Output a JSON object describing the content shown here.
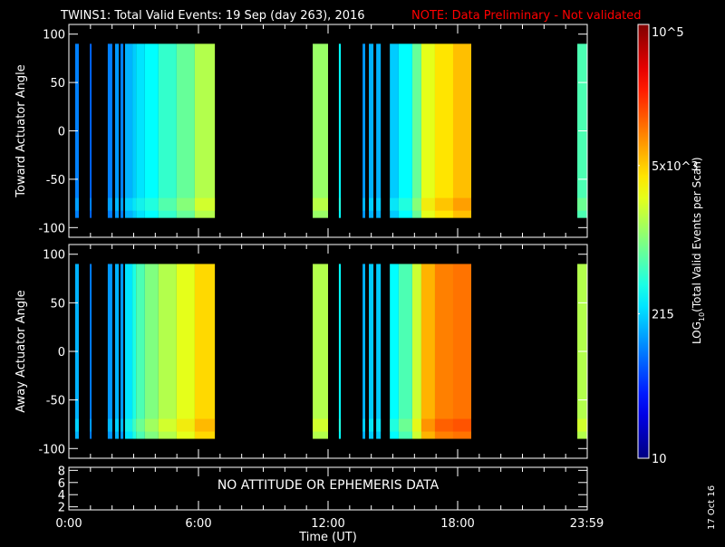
{
  "title": "TWINS1: Total Valid Events: 19 Sep (day 263), 2016",
  "note": "NOTE: Data Preliminary - Not validated",
  "date_stamp": "17 Oct 16",
  "chart_data": [
    {
      "type": "heatmap",
      "panel": "toward",
      "ylabel": "Toward Actuator Angle",
      "ylim": [
        -110,
        110
      ],
      "yticks": [
        "100",
        "50",
        "0",
        "-50",
        "-100"
      ],
      "data_range_deg": [
        -90,
        90
      ],
      "segments_hours_log10": [
        [
          0.29,
          0.46,
          2.0
        ],
        [
          0.97,
          1.05,
          1.9
        ],
        [
          1.8,
          2.01,
          2.0
        ],
        [
          2.14,
          2.31,
          2.1
        ],
        [
          2.39,
          2.52,
          2.0
        ],
        [
          2.6,
          2.94,
          2.2
        ],
        [
          2.94,
          3.11,
          2.3
        ],
        [
          3.11,
          3.52,
          2.4
        ],
        [
          3.52,
          4.15,
          2.5
        ],
        [
          4.15,
          4.99,
          2.7
        ],
        [
          4.99,
          5.83,
          2.9
        ],
        [
          5.83,
          6.76,
          3.2
        ],
        [
          11.29,
          12.0,
          3.1
        ],
        [
          12.5,
          12.59,
          2.5
        ],
        [
          13.6,
          13.72,
          2.1
        ],
        [
          13.89,
          14.1,
          2.2
        ],
        [
          14.23,
          14.44,
          2.2
        ],
        [
          14.86,
          15.27,
          2.3
        ],
        [
          15.27,
          15.9,
          2.5
        ],
        [
          15.9,
          16.32,
          2.9
        ],
        [
          16.32,
          16.95,
          3.4
        ],
        [
          16.95,
          17.79,
          3.6
        ],
        [
          17.79,
          18.63,
          3.75
        ],
        [
          23.54,
          24.0,
          2.8
        ]
      ]
    },
    {
      "type": "heatmap",
      "panel": "away",
      "ylabel": "Away Actuator Angle",
      "ylim": [
        -110,
        110
      ],
      "yticks": [
        "100",
        "50",
        "0",
        "-50",
        "-100"
      ],
      "data_range_deg": [
        -90,
        90
      ],
      "segments_hours_log10": [
        [
          0.29,
          0.46,
          2.2
        ],
        [
          0.97,
          1.05,
          2.0
        ],
        [
          1.8,
          2.01,
          2.1
        ],
        [
          2.14,
          2.31,
          2.2
        ],
        [
          2.39,
          2.52,
          2.1
        ],
        [
          2.6,
          2.94,
          2.4
        ],
        [
          2.94,
          3.11,
          2.6
        ],
        [
          3.11,
          3.52,
          2.8
        ],
        [
          3.52,
          4.15,
          3.0
        ],
        [
          4.15,
          4.99,
          3.2
        ],
        [
          4.99,
          5.83,
          3.4
        ],
        [
          5.83,
          6.76,
          3.65
        ],
        [
          11.29,
          12.0,
          3.2
        ],
        [
          12.5,
          12.59,
          2.5
        ],
        [
          13.6,
          13.72,
          2.2
        ],
        [
          13.89,
          14.1,
          2.3
        ],
        [
          14.23,
          14.44,
          2.3
        ],
        [
          14.86,
          15.27,
          2.5
        ],
        [
          15.27,
          15.9,
          2.8
        ],
        [
          15.9,
          16.32,
          3.3
        ],
        [
          16.32,
          16.95,
          3.8
        ],
        [
          16.95,
          17.79,
          4.0
        ],
        [
          17.79,
          18.63,
          4.05
        ],
        [
          23.54,
          24.0,
          3.2
        ]
      ]
    },
    {
      "type": "line",
      "panel": "ephemeris",
      "yticks": [
        "8",
        "6",
        "4",
        "2"
      ],
      "ylim": [
        1.5,
        8.5
      ],
      "message": "NO ATTITUDE OR EPHEMERIS DATA"
    }
  ],
  "xaxis": {
    "label": "Time (UT)",
    "xlim": [
      0,
      24
    ],
    "ticks": [
      {
        "hour": 0,
        "label": "0:00"
      },
      {
        "hour": 6,
        "label": "6:00"
      },
      {
        "hour": 12,
        "label": "12:00"
      },
      {
        "hour": 18,
        "label": "18:00"
      },
      {
        "hour": 23.98,
        "label": "23:59"
      }
    ]
  },
  "colorbar": {
    "label": "LOG10(Total Valid Events per Scan)",
    "label_main": "LOG",
    "label_sub": "10",
    "label_rest": "(Total Valid Events per Scan)",
    "range_log10": [
      1,
      5
    ],
    "ticks": [
      {
        "log10": 1,
        "label": "10"
      },
      {
        "log10": 2.332,
        "label": "215"
      },
      {
        "log10": 3.699,
        "label": "5x10^3"
      },
      {
        "log10": 5,
        "label": "10^5"
      }
    ]
  },
  "colors": {
    "note": "#ff0000",
    "axes": "#ffffff",
    "background": "#000000"
  }
}
